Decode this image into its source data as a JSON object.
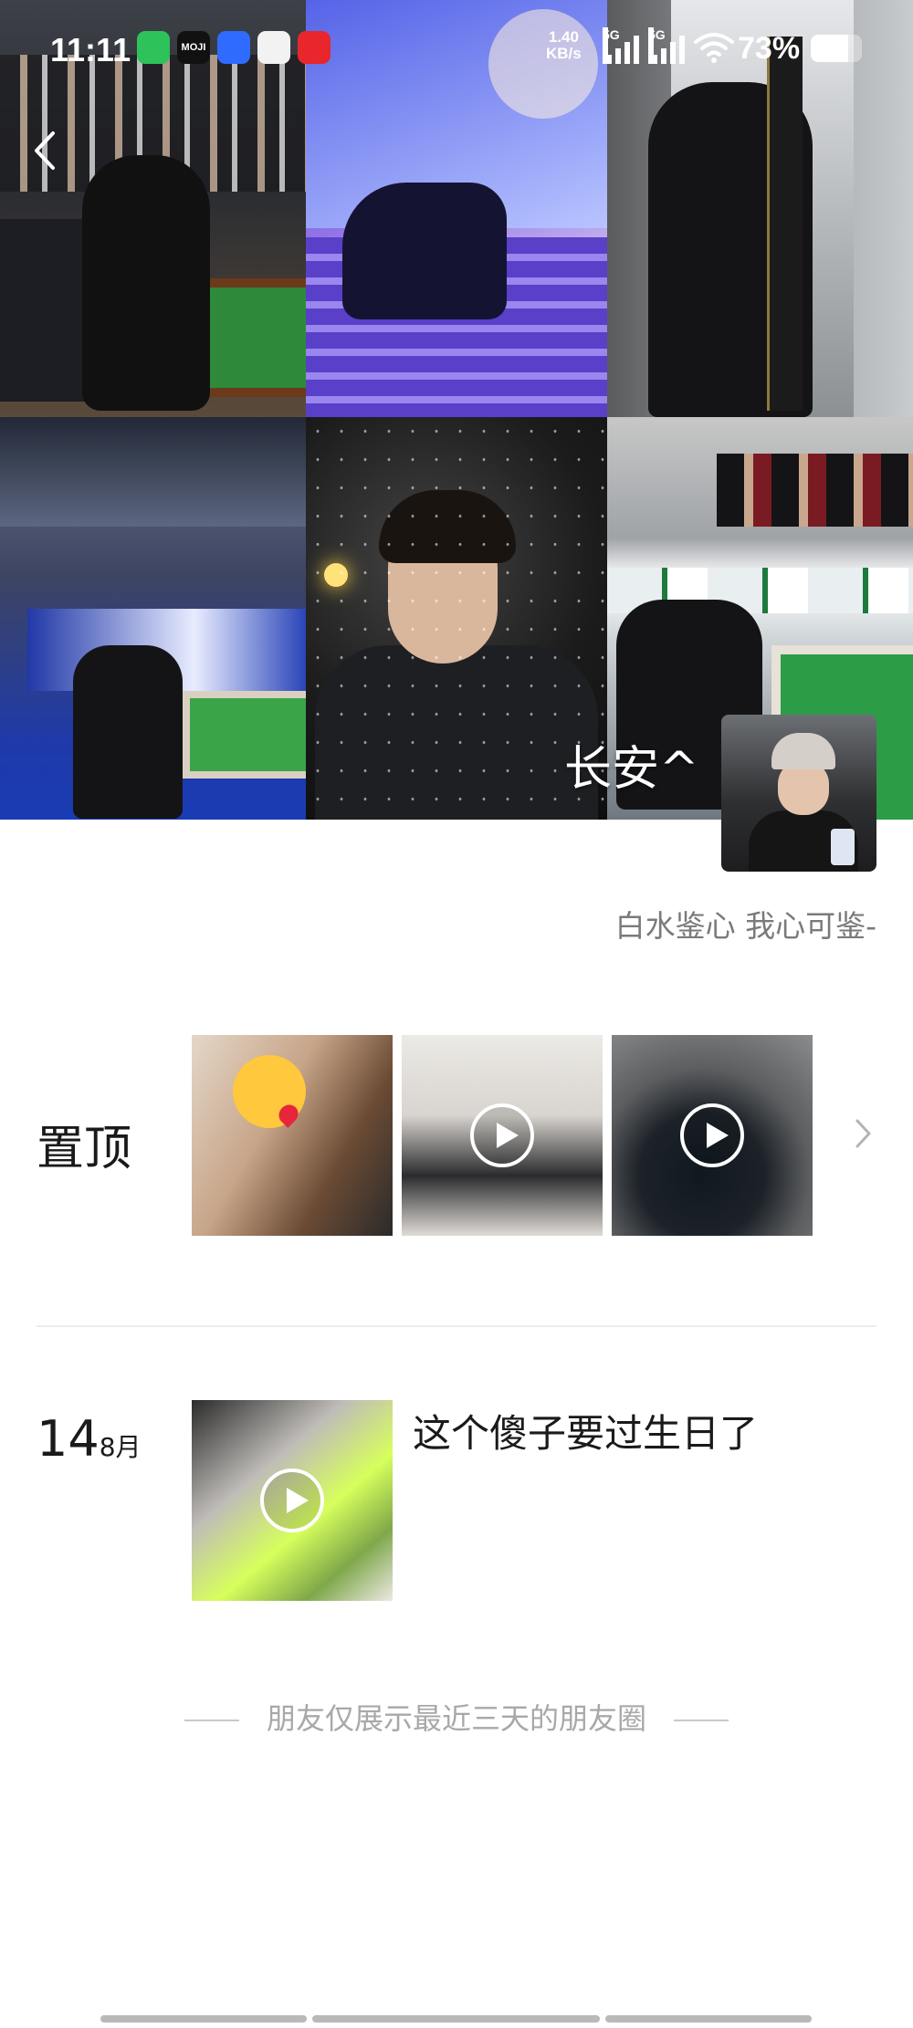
{
  "status_bar": {
    "time": "11:11",
    "network_speed_value": "1.40",
    "network_speed_unit": "KB/s",
    "signal_1_label": "5G",
    "signal_2_label": "5G",
    "battery_percent": "73%",
    "battery_level": 0.73,
    "app_icons": [
      "wechat-icon",
      "moji-icon",
      "baidu-icon",
      "clown-icon",
      "heart-icon"
    ],
    "moji_text": "MOJI"
  },
  "profile": {
    "nickname": "长安^",
    "signature": "白水鉴心 我心可鉴-"
  },
  "pinned": {
    "label": "置顶",
    "items": [
      {
        "type": "image"
      },
      {
        "type": "video"
      },
      {
        "type": "video"
      }
    ]
  },
  "posts": [
    {
      "day": "14",
      "month": "8月",
      "text": "这个傻子要过生日了",
      "media_type": "video"
    }
  ],
  "footer_notice": "朋友仅展示最近三天的朋友圈",
  "colors": {
    "wechat_green": "#2dc25a",
    "text_primary": "#1a1a1a",
    "text_secondary": "#7a7a7a",
    "text_muted": "#a8a8a8"
  }
}
